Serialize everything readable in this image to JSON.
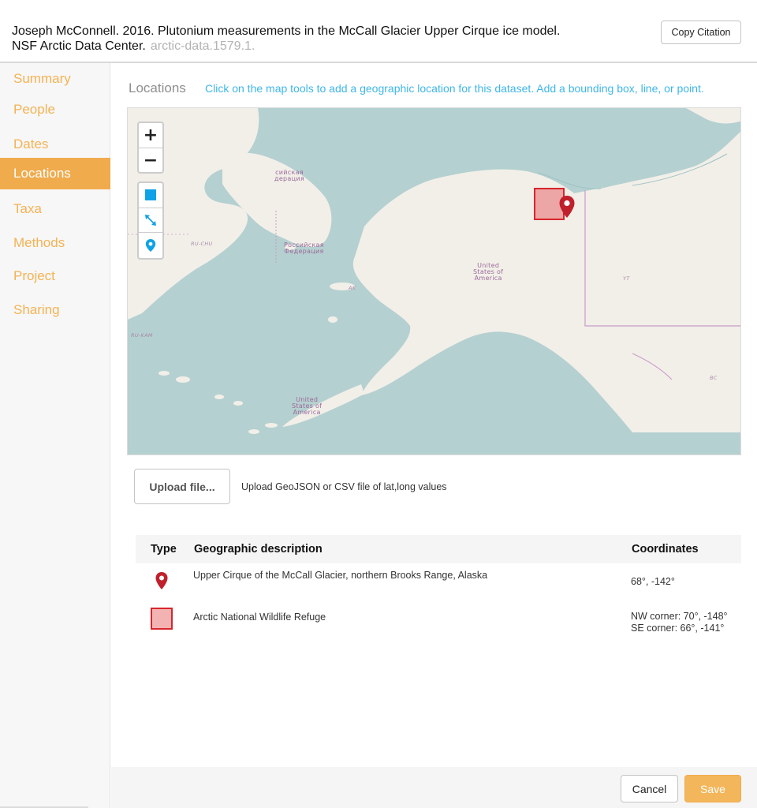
{
  "header": {
    "citation_line1": "Joseph McConnell. 2016. Plutonium measurements in the McCall Glacier Upper Cirque ice model.",
    "citation_line2": "NSF Arctic Data Center.",
    "dataset_id": "arctic-data.1579.1.",
    "copy_citation_label": "Copy Citation"
  },
  "sidebar": {
    "items": [
      {
        "label": "Summary",
        "active": false
      },
      {
        "label": "People",
        "active": false
      },
      {
        "label": "Dates",
        "active": false
      },
      {
        "label": "Locations",
        "active": true
      },
      {
        "label": "Taxa",
        "active": false
      },
      {
        "label": "Methods",
        "active": false
      },
      {
        "label": "Project",
        "active": false
      },
      {
        "label": "Sharing",
        "active": false
      }
    ]
  },
  "locations": {
    "title": "Locations",
    "hint": "Click on the map tools to add a geographic location for this dataset. Add a bounding box, line, or point."
  },
  "map": {
    "zoom_in": "+",
    "zoom_out": "−",
    "tools": [
      "rectangle-icon",
      "line-icon",
      "point-marker-icon"
    ],
    "labels": {
      "ru_top": "сийская\nдерация",
      "ru_main": "Российская\nФедерация",
      "ru_chu": "RU-CHU",
      "ru_kam": "RU-KAM",
      "ak": "AK",
      "usa_north": "United\nStates of\nAmerica",
      "usa_south": "United\nStates of\nAmerica",
      "yt": "YT",
      "bc": "BC"
    },
    "colors": {
      "water": "#b5d0d0",
      "land": "#f2efe9",
      "border": "#c99bc9",
      "bbox_stroke": "#d7262d",
      "marker": "#c0202b"
    }
  },
  "upload": {
    "button_label": "Upload file...",
    "hint": "Upload GeoJSON or CSV file of lat,long values"
  },
  "table": {
    "headers": {
      "type": "Type",
      "description": "Geographic description",
      "coordinates": "Coordinates"
    },
    "rows": [
      {
        "type_icon": "point-marker-icon",
        "description": "Upper Cirque of the McCall Glacier, northern Brooks Range, Alaska",
        "coordinates": [
          "68°, -142°"
        ]
      },
      {
        "type_icon": "bounding-box-icon",
        "description": "Arctic National Wildlife Refuge",
        "coordinates": [
          "NW corner: 70°, -148°",
          "SE corner: 66°, -141°"
        ]
      }
    ]
  },
  "footer": {
    "cancel_label": "Cancel",
    "save_label": "Save"
  }
}
